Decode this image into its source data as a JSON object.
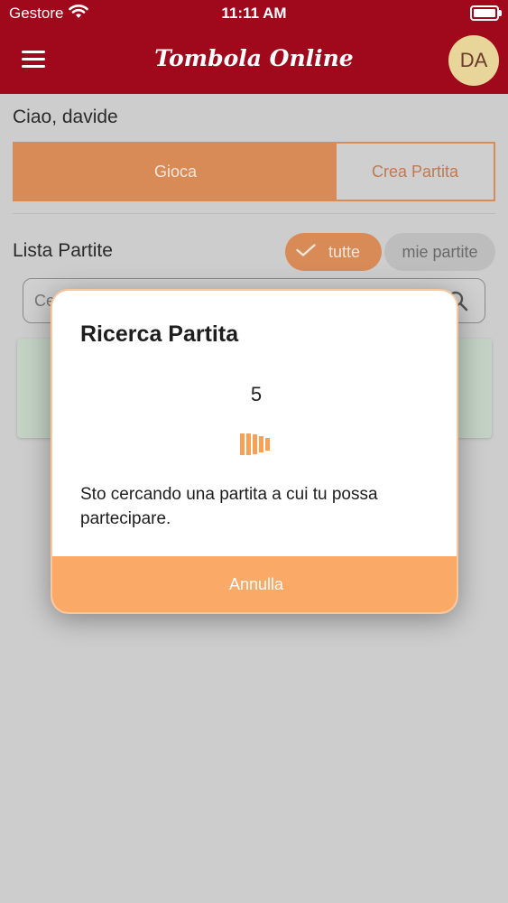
{
  "status_bar": {
    "carrier": "Gestore",
    "time": "11:11 AM"
  },
  "header": {
    "title": "Tombola Online",
    "avatar_initials": "DA"
  },
  "page": {
    "greeting": "Ciao, davide",
    "segments": {
      "play": "Gioca",
      "create": "Crea Partita"
    },
    "list_title": "Lista Partite",
    "filters": {
      "all": "tutte",
      "mine": "mie partite"
    },
    "search_placeholder": "Ce"
  },
  "modal": {
    "title": "Ricerca Partita",
    "countdown": "5",
    "message": "Sto cercando una partita a cui tu possa partecipare.",
    "cancel_label": "Annulla"
  },
  "colors": {
    "header": "#a0081c",
    "accent": "#d88b57",
    "modal_button": "#fba966"
  },
  "icons": [
    "wifi-icon",
    "battery-icon",
    "menu-icon",
    "check-icon",
    "search-icon",
    "loading-bars-icon"
  ]
}
